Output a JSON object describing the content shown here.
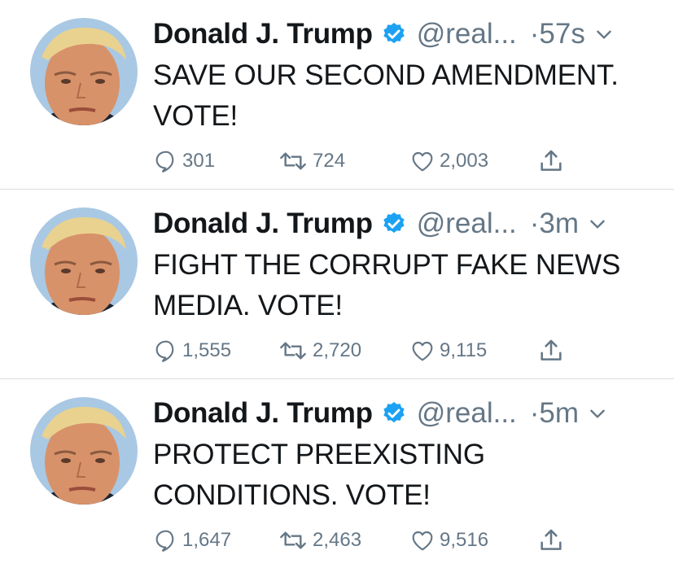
{
  "tweets": [
    {
      "name": "Donald J. Trump",
      "handle": "@real...",
      "time": "·57s",
      "text_lines": [
        "SAVE OUR SECOND AMENDMENT.",
        "VOTE!"
      ],
      "replies": "301",
      "retweets": "724",
      "likes": "2,003"
    },
    {
      "name": "Donald J. Trump",
      "handle": "@real...",
      "time": "·3m",
      "text_lines": [
        "FIGHT THE CORRUPT FAKE NEWS",
        "MEDIA. VOTE!"
      ],
      "replies": "1,555",
      "retweets": "2,720",
      "likes": "9,115"
    },
    {
      "name": "Donald J. Trump",
      "handle": "@real...",
      "time": "·5m",
      "text_lines": [
        "PROTECT PREEXISTING",
        "CONDITIONS. VOTE!"
      ],
      "replies": "1,647",
      "retweets": "2,463",
      "likes": "9,516"
    }
  ],
  "icons": {
    "verified": "verified-badge-icon",
    "caret": "chevron-down-icon",
    "reply": "reply-icon",
    "retweet": "retweet-icon",
    "like": "heart-icon",
    "share": "share-icon"
  },
  "colors": {
    "verified": "#1da1f2",
    "muted": "#657786",
    "text": "#14171a",
    "divider": "#d8dde1"
  }
}
